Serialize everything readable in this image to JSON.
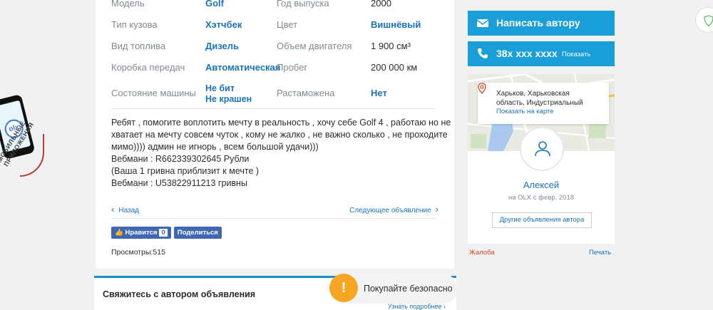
{
  "promo": {
    "logo": "olx",
    "text": "МОБИЛЬНЫЕ ПРИЛОЖЕНИЯ"
  },
  "params": [
    {
      "label": "Модель",
      "value": "Golf",
      "label2": "Год выпуска",
      "value2": "2000"
    },
    {
      "label": "Тип кузова",
      "value": "Хэтчбек",
      "label2": "Цвет",
      "value2": "Вишнёвый"
    },
    {
      "label": "Вид топлива",
      "value": "Дизель",
      "label2": "Объем двигателя",
      "value2": "1 900 см³"
    },
    {
      "label": "Коробка передач",
      "value": "Автоматическая",
      "label2": "Пробег",
      "value2": "200 000 км"
    },
    {
      "label": "Состояние машины",
      "value": "Не бит",
      "value_b": "Не крашен",
      "label2": "Растаможена",
      "value2": "Нет"
    }
  ],
  "description": [
    "Ребят , помогите воплотить мечту в реальность , хочу себе Golf 4 , работаю но не",
    "хватает на мечту совсем чуток , кому не жалко , не важно сколько , не проходите",
    "мимо)))) админ не игнорь , всем большой удачи)))",
    "Вебмани : R662339302645 Рубли",
    "(Ваша 1 гривна приблизит к мечте )",
    "Вебмани : U53822911213 гривны"
  ],
  "nav": {
    "prev": "Назад",
    "next": "Следующее объявление"
  },
  "social": {
    "like": "Нравится",
    "like_count": "0",
    "share": "Поделиться"
  },
  "views": {
    "label": "Просмотры:",
    "count": "515"
  },
  "contact": {
    "title": "Свяжитесь с автором объявления",
    "safe_buy": "Покупайте безопасно",
    "learn_more": "Узнать подробнее ›"
  },
  "author_actions": {
    "write": "Написать автору",
    "phone": "38х ххх хххх",
    "show": "Показать"
  },
  "location": {
    "line1": "Харьков, Харьковская",
    "line2": "область, Индустриальный",
    "map_link": "Показать на карте"
  },
  "author": {
    "name": "Алексей",
    "since": "на OLX с февр. 2018",
    "other_ads": "Другие объявления автора"
  },
  "footer_links": {
    "complaint": "Жалоба",
    "print": "Печать"
  },
  "colors": {
    "accent": "#199ed8",
    "link": "#1a73b8",
    "warning": "#f6a623",
    "complaint": "#d5441c"
  }
}
